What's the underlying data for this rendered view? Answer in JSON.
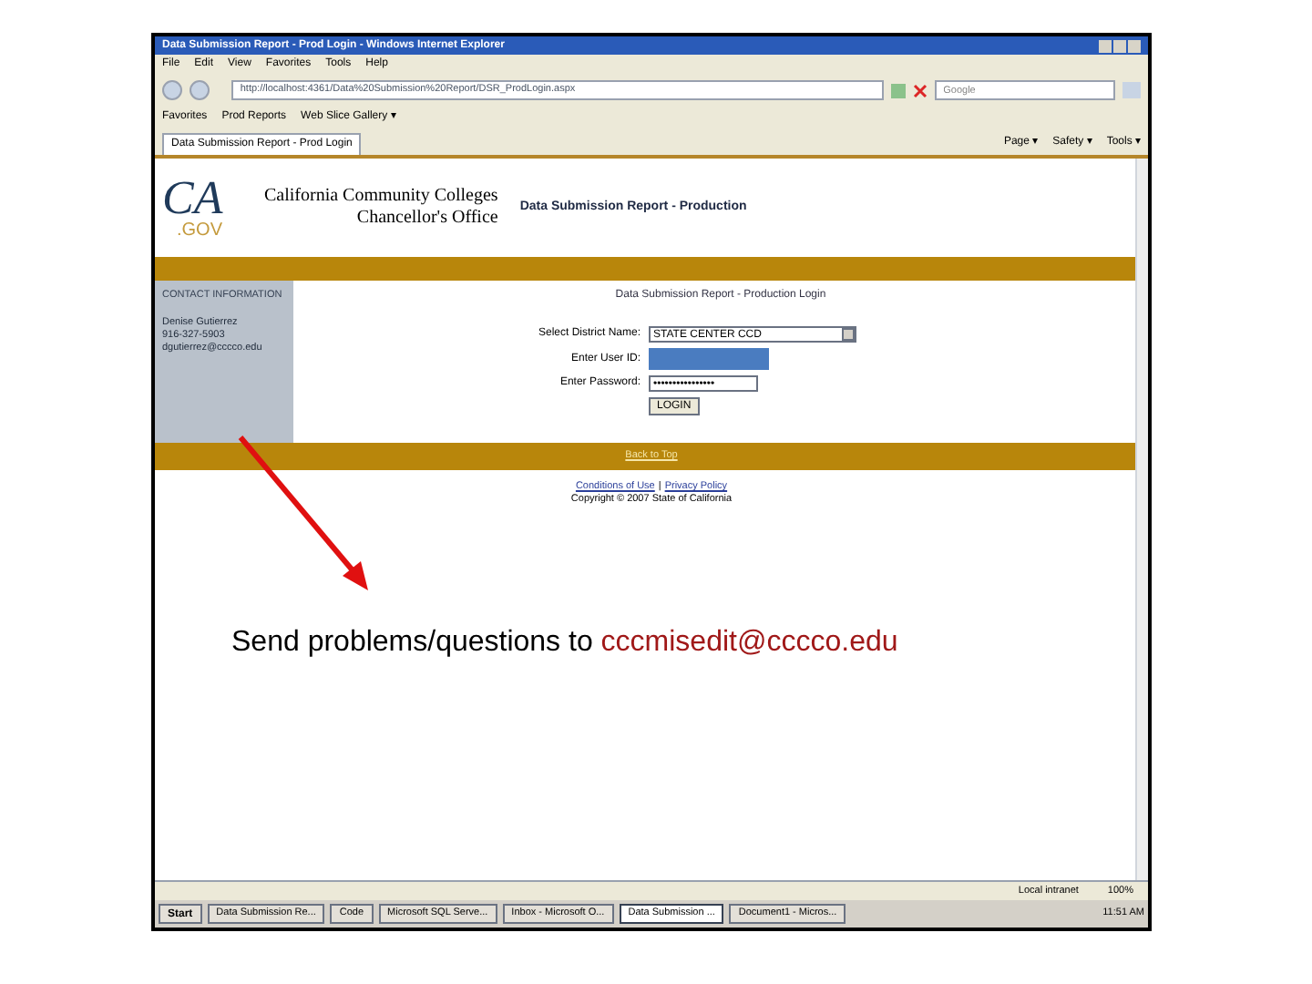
{
  "window": {
    "title": "Data Submission Report - Prod Login - Windows Internet Explorer"
  },
  "menu": [
    "File",
    "Edit",
    "View",
    "Favorites",
    "Tools",
    "Help"
  ],
  "address_bar": {
    "value": "http://localhost:4361/Data%20Submission%20Report/DSR_ProdLogin.aspx"
  },
  "search": {
    "placeholder": "Google"
  },
  "favorites_bar": [
    "Favorites",
    "Prod Reports",
    "Web Slice Gallery ▾"
  ],
  "tabs": [
    {
      "label": "Data Submission Report - Prod Login",
      "selected": true
    }
  ],
  "command_bar": [
    "Page ▾",
    "Safety ▾",
    "Tools ▾"
  ],
  "header": {
    "logo_ca": "CA",
    "logo_gov": ".GOV",
    "org_line_1": "California Community Colleges",
    "org_line_2": "Chancellor's Office",
    "title": "Data Submission Report - Production"
  },
  "sidebar": {
    "heading": "CONTACT INFORMATION",
    "contact": [
      "Denise Gutierrez",
      "916-327-5903",
      "dgutierrez@cccco.edu"
    ]
  },
  "login": {
    "title": "Data Submission Report - Production Login",
    "fields": [
      {
        "kind": "select",
        "label": "Select District Name:",
        "value": "STATE CENTER CCD"
      },
      {
        "kind": "redacted",
        "label": "Enter User ID:"
      },
      {
        "kind": "password",
        "label": "Enter Password:",
        "value": "••••••••••••••••"
      }
    ],
    "button": "LOGIN"
  },
  "back_to_top": "Back to Top",
  "footer": {
    "links": [
      "Conditions of Use",
      "Privacy Policy"
    ],
    "separator": "|",
    "copyright": "Copyright © 2007 State of California"
  },
  "status_bar": {
    "zone": "Local intranet",
    "zoom": "100%"
  },
  "taskbar": {
    "start": "Start",
    "items": [
      {
        "label": "Data Submission Re...",
        "selected": false
      },
      {
        "label": "Code",
        "selected": false
      },
      {
        "label": "Microsoft SQL Serve...",
        "selected": false
      },
      {
        "label": "Inbox - Microsoft O...",
        "selected": false
      },
      {
        "label": "Data Submission ...",
        "selected": true
      },
      {
        "label": "Document1 - Micros...",
        "selected": false
      }
    ],
    "clock": "11:51 AM"
  },
  "caption": {
    "text": "Send problems/questions to ",
    "email": "cccmisedit@cccco.edu"
  }
}
